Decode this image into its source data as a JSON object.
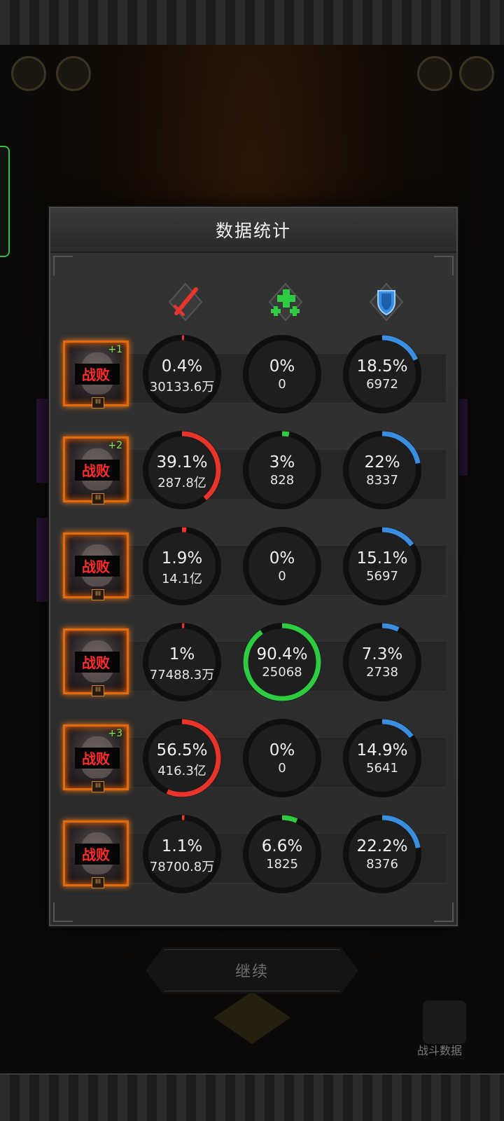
{
  "panel": {
    "title": "数据统计",
    "columns": [
      {
        "name": "damage",
        "icon": "sword-icon",
        "color": "#e8342a"
      },
      {
        "name": "healing",
        "icon": "heal-cross-icon",
        "color": "#2ecc40"
      },
      {
        "name": "defense",
        "icon": "shield-icon",
        "color": "#3a8ee0"
      }
    ],
    "rows": [
      {
        "status": "战败",
        "plus": "+1",
        "damage": {
          "pct": "0.4%",
          "value": "30133.6万",
          "fraction": 0.004
        },
        "healing": {
          "pct": "0%",
          "value": "0",
          "fraction": 0
        },
        "defense": {
          "pct": "18.5%",
          "value": "6972",
          "fraction": 0.185
        }
      },
      {
        "status": "战败",
        "plus": "+2",
        "damage": {
          "pct": "39.1%",
          "value": "287.8亿",
          "fraction": 0.391
        },
        "healing": {
          "pct": "3%",
          "value": "828",
          "fraction": 0.03
        },
        "defense": {
          "pct": "22%",
          "value": "8337",
          "fraction": 0.22
        }
      },
      {
        "status": "战败",
        "plus": "",
        "damage": {
          "pct": "1.9%",
          "value": "14.1亿",
          "fraction": 0.019
        },
        "healing": {
          "pct": "0%",
          "value": "0",
          "fraction": 0
        },
        "defense": {
          "pct": "15.1%",
          "value": "5697",
          "fraction": 0.151
        }
      },
      {
        "status": "战败",
        "plus": "",
        "damage": {
          "pct": "1%",
          "value": "77488.3万",
          "fraction": 0.01
        },
        "healing": {
          "pct": "90.4%",
          "value": "25068",
          "fraction": 0.904
        },
        "defense": {
          "pct": "7.3%",
          "value": "2738",
          "fraction": 0.073
        }
      },
      {
        "status": "战败",
        "plus": "+3",
        "damage": {
          "pct": "56.5%",
          "value": "416.3亿",
          "fraction": 0.565
        },
        "healing": {
          "pct": "0%",
          "value": "0",
          "fraction": 0
        },
        "defense": {
          "pct": "14.9%",
          "value": "5641",
          "fraction": 0.149
        }
      },
      {
        "status": "战败",
        "plus": "",
        "damage": {
          "pct": "1.1%",
          "value": "78700.8万",
          "fraction": 0.011
        },
        "healing": {
          "pct": "6.6%",
          "value": "1825",
          "fraction": 0.066
        },
        "defense": {
          "pct": "22.2%",
          "value": "8376",
          "fraction": 0.222
        }
      }
    ]
  },
  "continue_button": {
    "label": "继续"
  },
  "battle_data_button": {
    "label": "战斗数据"
  },
  "rank_mark": "III"
}
